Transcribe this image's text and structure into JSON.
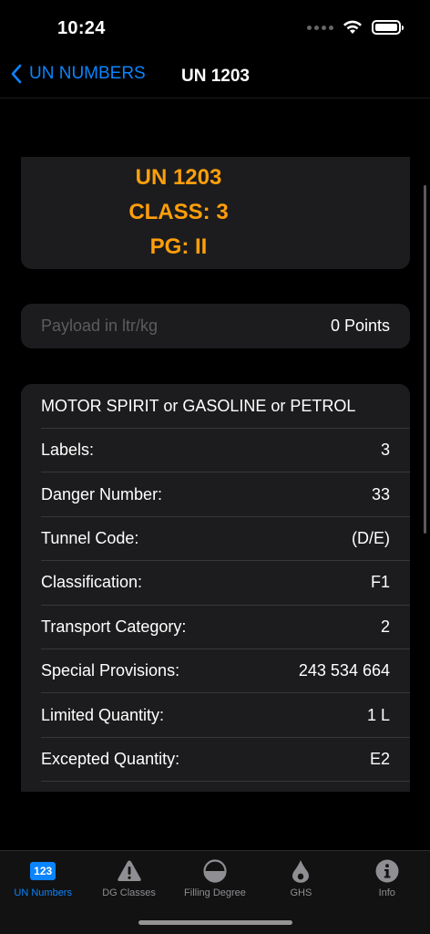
{
  "status_bar": {
    "time": "10:24"
  },
  "nav": {
    "back_label": "UN NUMBERS",
    "title": "UN 1203"
  },
  "header": {
    "un": "UN 1203",
    "class": "CLASS: 3",
    "pg": "PG: II"
  },
  "payload": {
    "placeholder": "Payload in ltr/kg",
    "value": "",
    "points": "0 Points"
  },
  "details": {
    "name": "MOTOR SPIRIT or GASOLINE or PETROL",
    "rows": [
      {
        "label": "Labels:",
        "value": "3"
      },
      {
        "label": "Danger Number:",
        "value": "33"
      },
      {
        "label": "Tunnel Code:",
        "value": "(D/E)"
      },
      {
        "label": "Classification:",
        "value": "F1"
      },
      {
        "label": "Transport Category:",
        "value": "2"
      },
      {
        "label": "Special Provisions:",
        "value": "243 534 664"
      },
      {
        "label": "Limited Quantity:",
        "value": "1 L"
      },
      {
        "label": "Excepted Quantity:",
        "value": "E2"
      }
    ]
  },
  "tabs": [
    {
      "label": "UN Numbers",
      "icon": "123-badge-icon",
      "badge": "123",
      "active": true
    },
    {
      "label": "DG Classes",
      "icon": "warning-triangle-icon",
      "active": false
    },
    {
      "label": "Filling Degree",
      "icon": "half-circle-icon",
      "active": false
    },
    {
      "label": "GHS",
      "icon": "drop-icon",
      "active": false
    },
    {
      "label": "Info",
      "icon": "info-icon",
      "active": false
    }
  ],
  "colors": {
    "accent": "#0a84ff",
    "highlight": "#ff9f0a",
    "card": "#1c1c1e",
    "background": "#000000"
  }
}
